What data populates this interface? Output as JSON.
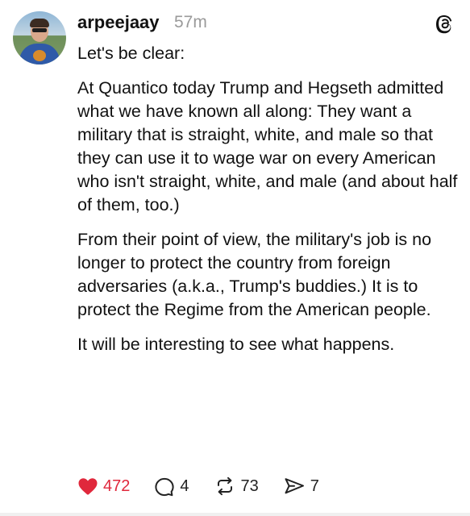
{
  "post": {
    "author": {
      "username": "arpeejaay",
      "avatar_icon": "user-avatar-photo"
    },
    "time_ago": "57m",
    "app_icon": "threads-icon",
    "paragraphs": [
      "Let's be clear:",
      "At Quantico today Trump and Hegseth admitted what we have known all along: They want a military that is straight, white, and male so that they can use it to wage war on every American who isn't straight, white, and male (and about half of them, too.)",
      "From their point of view, the military's job is no longer to protect the country from foreign adversaries (a.k.a., Trump's buddies.) It is to protect the Regime from the American people.",
      "It will be interesting to see what happens."
    ],
    "actions": {
      "likes": {
        "count": "472",
        "icon": "heart-icon",
        "liked": true
      },
      "replies": {
        "count": "4",
        "icon": "comment-icon"
      },
      "reposts": {
        "count": "73",
        "icon": "repost-icon"
      },
      "shares": {
        "count": "7",
        "icon": "send-icon"
      }
    }
  },
  "colors": {
    "like_red": "#e0283c",
    "muted_gray": "#9a9a9a",
    "text": "#111111"
  }
}
